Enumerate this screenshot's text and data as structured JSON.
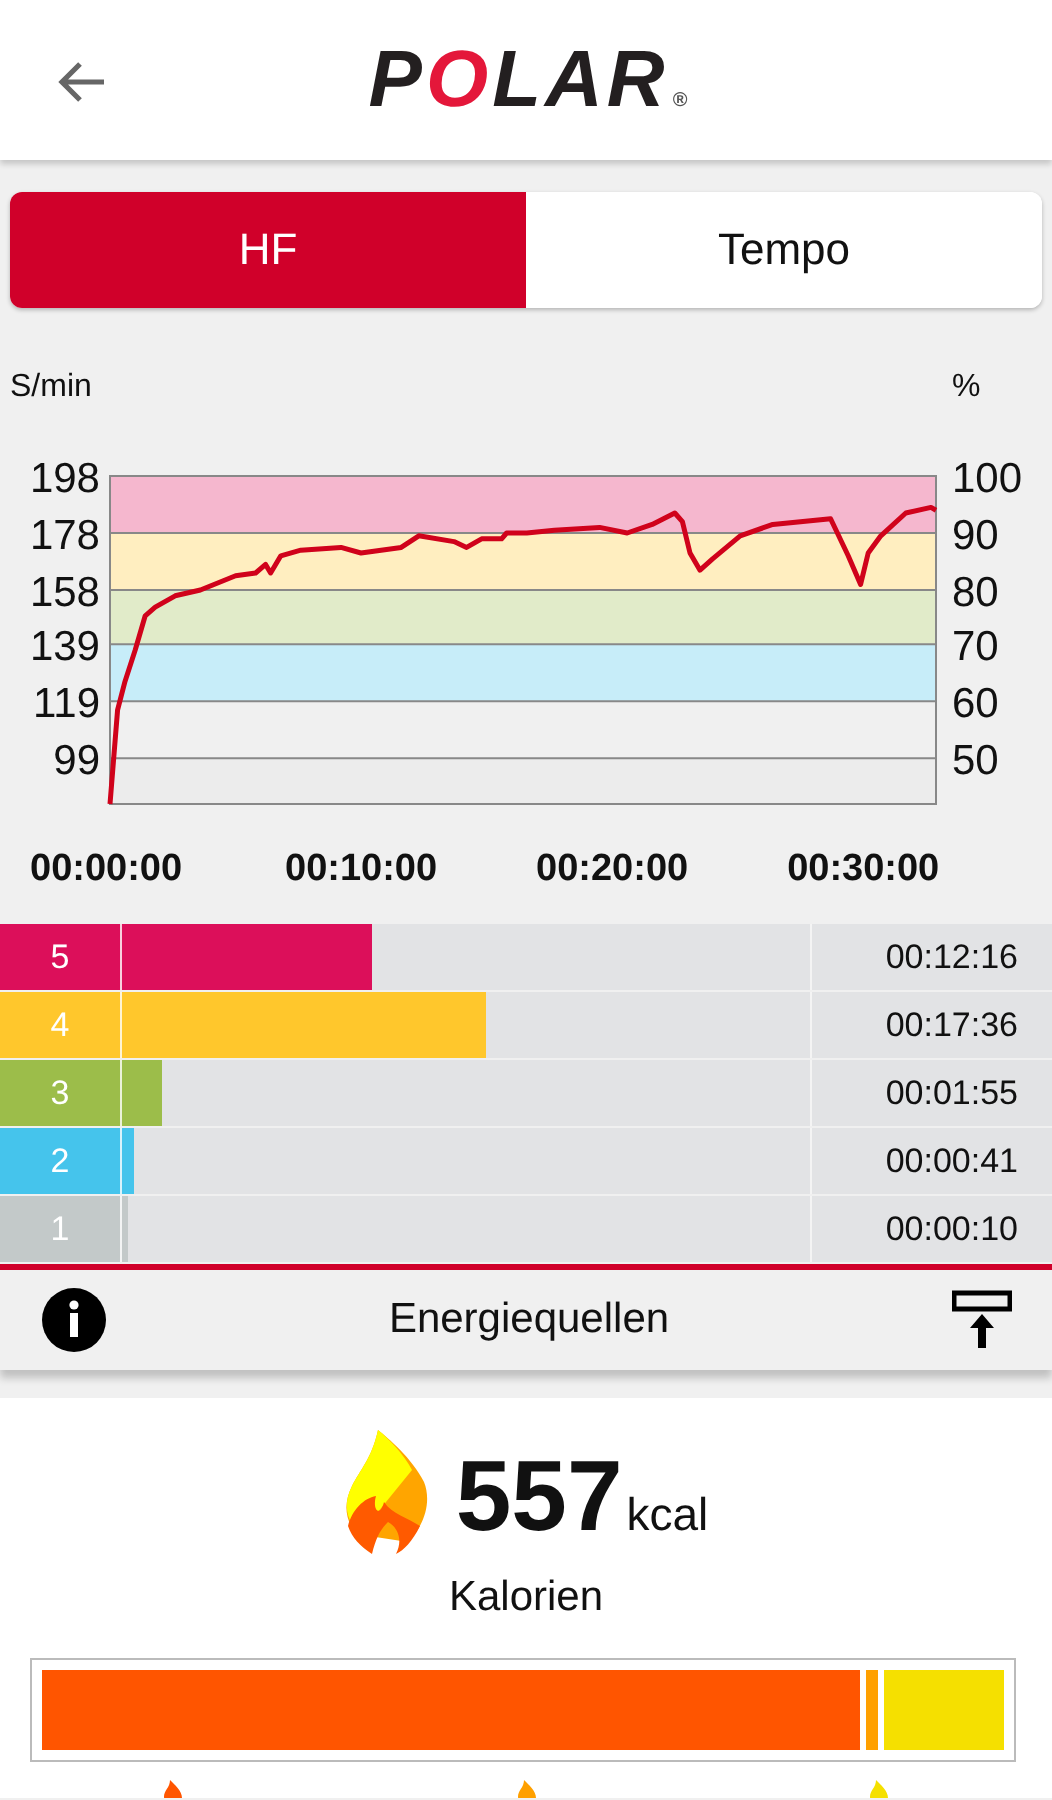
{
  "header": {
    "logo": "POLAR",
    "registered": "®"
  },
  "tabs": [
    {
      "label": "HF",
      "selected": true
    },
    {
      "label": "Tempo",
      "selected": false
    }
  ],
  "hr_chart": {
    "left_unit": "S/min",
    "right_unit": "%",
    "percent_ticks": [
      "100",
      "90",
      "80",
      "70",
      "60",
      "50"
    ],
    "chart_data": {
      "type": "line",
      "x": [
        0,
        0.3,
        0.6,
        1.0,
        1.4,
        1.8,
        2.6,
        3.6,
        5.0,
        5.8,
        6.2,
        6.4,
        6.8,
        7.6,
        9.2,
        10,
        11.6,
        12.3,
        13.7,
        14.2,
        14.8,
        15.6,
        15.8,
        16.6,
        17.7,
        19.5,
        20.6,
        21.6,
        22.5,
        22.8,
        23.1,
        23.5,
        24,
        25.1,
        26.4,
        28.7,
        29.4,
        29.9,
        30.2,
        30.7,
        31.7,
        32.7,
        32.9
      ],
      "grid": true,
      "bands": [
        {
          "axis": "y",
          "from": 178,
          "to": 198,
          "color": "#f5b7ce"
        },
        {
          "axis": "y",
          "from": 158,
          "to": 178,
          "color": "#ffeec0"
        },
        {
          "axis": "y",
          "from": 139,
          "to": 158,
          "color": "#e1ebc9"
        },
        {
          "axis": "y",
          "from": 119,
          "to": 139,
          "color": "#c7edf9"
        }
      ],
      "series": [
        {
          "color": "#d0021b",
          "values": [
            83,
            116,
            126,
            137,
            149,
            152,
            156,
            158,
            163,
            164,
            167,
            164,
            170,
            172,
            173,
            171,
            173,
            177,
            175,
            173,
            176,
            176,
            178,
            178,
            179,
            180,
            178,
            181,
            185,
            182,
            171,
            165,
            169,
            177,
            181,
            183,
            170,
            160,
            171,
            177,
            185,
            187,
            186
          ]
        }
      ],
      "xlim": [
        0,
        32.9
      ],
      "ylim": [
        83,
        198
      ],
      "xticks": [
        {
          "value": 0,
          "label": "00:00:00"
        },
        {
          "value": 10,
          "label": "00:10:00"
        },
        {
          "value": 20,
          "label": "00:20:00"
        },
        {
          "value": 30,
          "label": "00:30:00"
        }
      ],
      "yticks": [
        99,
        119,
        139,
        158,
        178,
        198
      ]
    }
  },
  "zones": [
    {
      "label": "5",
      "time": "00:12:16",
      "level": 0.46,
      "color": "#dc0f5a"
    },
    {
      "label": "4",
      "time": "00:17:36",
      "level": 0.6,
      "color": "#ffc72c"
    },
    {
      "label": "3",
      "time": "00:01:55",
      "level": 0.2,
      "color": "#9cbd4a"
    },
    {
      "label": "2",
      "time": "00:00:41",
      "level": 0.166,
      "color": "#45c4ec"
    },
    {
      "label": "1",
      "time": "00:00:10",
      "level": 0.158,
      "color": "#c3c9c9"
    }
  ],
  "energy_sources": {
    "title": "Energiequellen"
  },
  "calories": {
    "value": "557",
    "unit": "kcal",
    "label": "Kalorien",
    "segments": [
      {
        "color": "#ff5500"
      },
      {
        "color": "#ffa000"
      },
      {
        "color": "#f5e000"
      }
    ]
  }
}
